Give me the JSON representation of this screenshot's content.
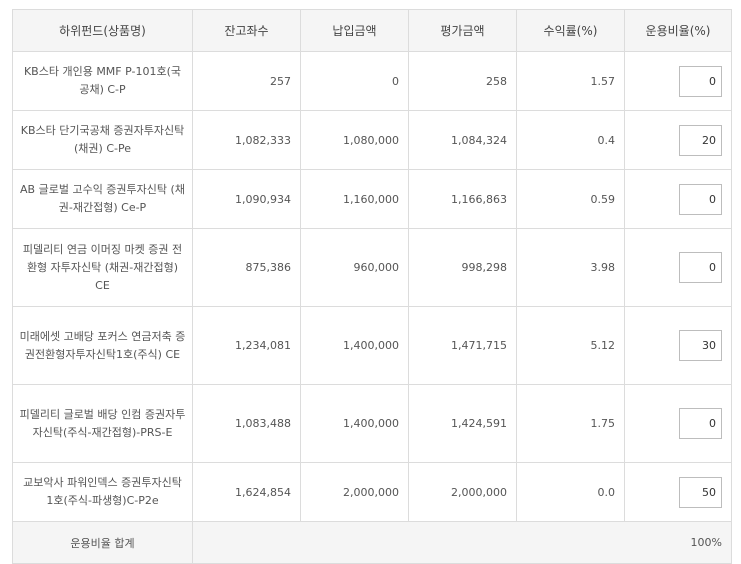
{
  "headers": {
    "fund_name": "하위펀드(상품명)",
    "balance": "잔고좌수",
    "paid_amount": "납입금액",
    "valuation": "평가금액",
    "return_rate": "수익률(%)",
    "allocation": "운용비율(%)"
  },
  "rows": [
    {
      "name": "KB스타 개인용 MMF P-101호(국공채) C-P",
      "balance": "257",
      "paid": "0",
      "valuation": "258",
      "return_rate": "1.57",
      "allocation": "0"
    },
    {
      "name": "KB스타 단기국공채 증권자투자신탁(채권) C-Pe",
      "balance": "1,082,333",
      "paid": "1,080,000",
      "valuation": "1,084,324",
      "return_rate": "0.4",
      "allocation": "20"
    },
    {
      "name": "AB 글로벌 고수익 증권투자신탁 (채권-재간접형) Ce-P",
      "balance": "1,090,934",
      "paid": "1,160,000",
      "valuation": "1,166,863",
      "return_rate": "0.59",
      "allocation": "0"
    },
    {
      "name": "피델리티 연금 이머징 마켓 증권 전환형 자투자신탁 (채권-재간접형) CE",
      "balance": "875,386",
      "paid": "960,000",
      "valuation": "998,298",
      "return_rate": "3.98",
      "allocation": "0"
    },
    {
      "name": "미래에셋 고배당 포커스 연금저축 증권전환형자투자신탁1호(주식) CE",
      "balance": "1,234,081",
      "paid": "1,400,000",
      "valuation": "1,471,715",
      "return_rate": "5.12",
      "allocation": "30"
    },
    {
      "name": "피델리티 글로벌 배당 인컴 증권자투자신탁(주식-재간접형)-PRS-E",
      "balance": "1,083,488",
      "paid": "1,400,000",
      "valuation": "1,424,591",
      "return_rate": "1.75",
      "allocation": "0"
    },
    {
      "name": "교보악사 파워인덱스 증권투자신탁 1호(주식-파생형)C-P2e",
      "balance": "1,624,854",
      "paid": "2,000,000",
      "valuation": "2,000,000",
      "return_rate": "0.0",
      "allocation": "50"
    }
  ],
  "total": {
    "label": "운용비율 합계",
    "value": "100%"
  }
}
